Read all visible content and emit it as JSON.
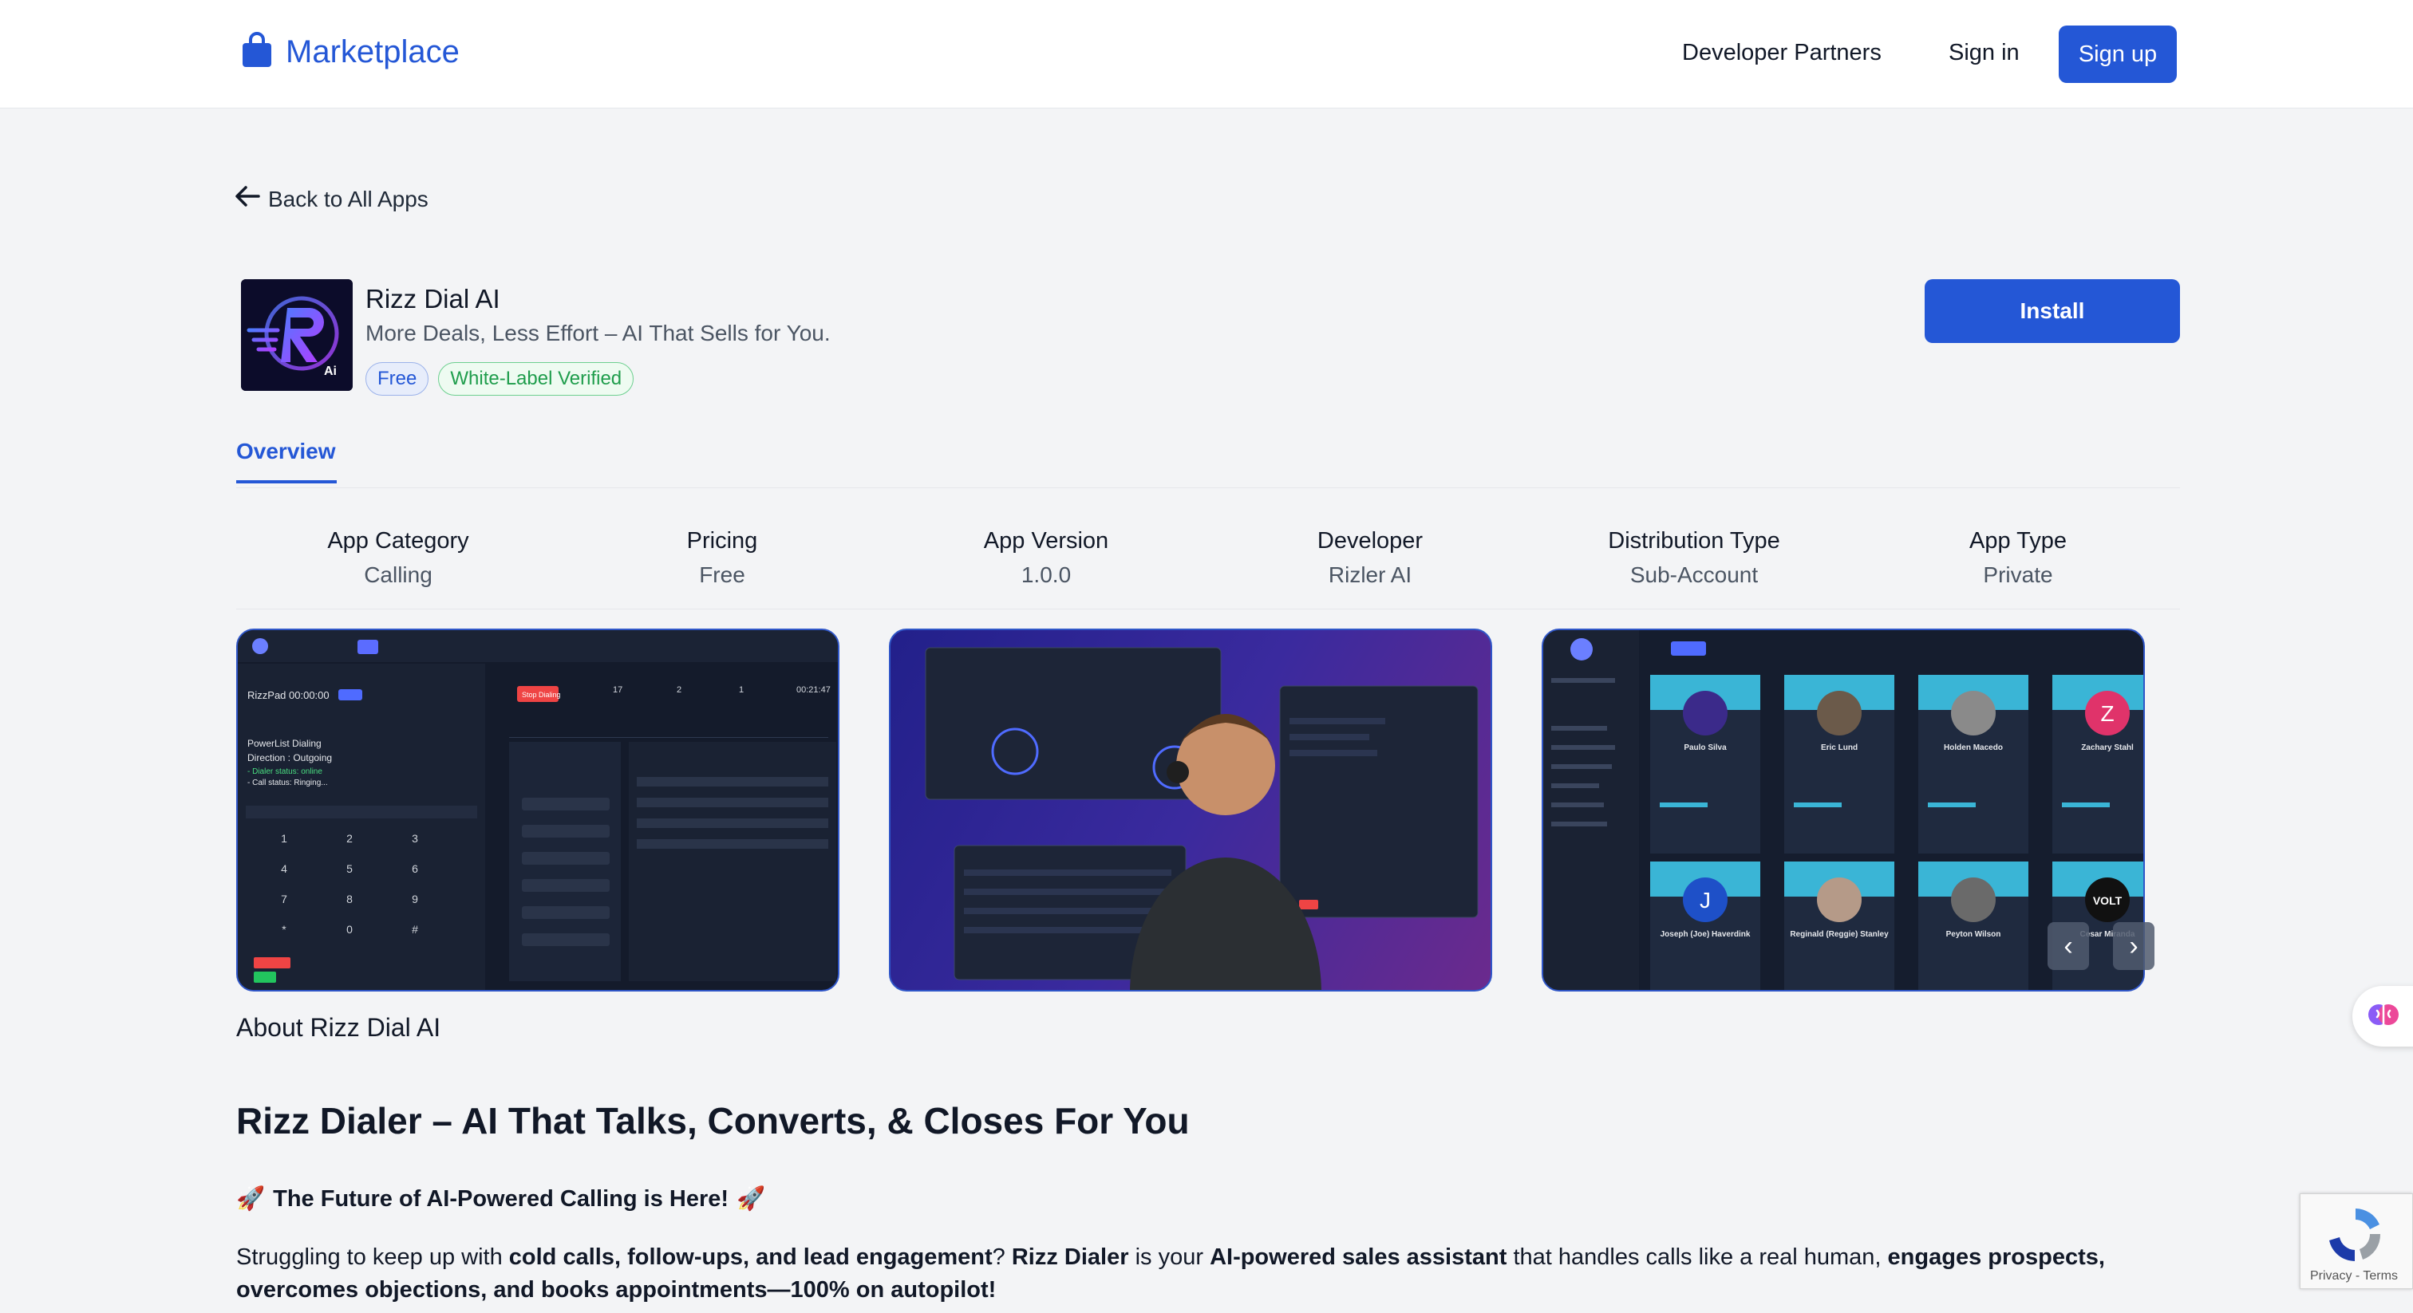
{
  "header": {
    "brand": "Marketplace",
    "nav": {
      "developer_partners": "Developer Partners",
      "sign_in": "Sign in",
      "sign_up": "Sign up"
    },
    "brand_color": "#2457d6"
  },
  "back_link": "Back to All Apps",
  "app": {
    "name": "Rizz Dial AI",
    "tagline": "More Deals, Less Effort – AI That Sells for You.",
    "badges": {
      "free": "Free",
      "white_label": "White-Label Verified"
    },
    "install_label": "Install",
    "logo_text": "Ai"
  },
  "tabs": {
    "overview": "Overview"
  },
  "info": [
    {
      "label": "App Category",
      "value": "Calling"
    },
    {
      "label": "Pricing",
      "value": "Free"
    },
    {
      "label": "App Version",
      "value": "1.0.0"
    },
    {
      "label": "Developer",
      "value": "Rizler AI"
    },
    {
      "label": "Distribution Type",
      "value": "Sub-Account"
    },
    {
      "label": "App Type",
      "value": "Private"
    }
  ],
  "screenshots": {
    "shot1": {
      "title": "RizzPad 00:00:00",
      "lines": [
        "PowerList Dialing",
        "Direction : Outgoing",
        "- Dialer status: online",
        "- Call status: Ringing..."
      ],
      "keys": [
        "1",
        "2",
        "3",
        "4",
        "5",
        "6",
        "7",
        "8",
        "9",
        "*",
        "0",
        "#"
      ],
      "stop_label": "Stop Dialing",
      "stats": [
        "17",
        "2",
        "1",
        "00:21:47"
      ]
    },
    "shot3": {
      "cards": [
        {
          "name": "Paulo Silva",
          "initial": ""
        },
        {
          "name": "Eric Lund",
          "initial": ""
        },
        {
          "name": "Holden Macedo",
          "initial": ""
        },
        {
          "name": "Zachary Stahl",
          "initial": "Z"
        },
        {
          "name": "Joseph (Joe) Haverdink",
          "initial": "J"
        },
        {
          "name": "Reginald (Reggie) Stanley",
          "initial": ""
        },
        {
          "name": "Peyton Wilson",
          "initial": ""
        },
        {
          "name": "Cesar Miranda",
          "initial": "VOLT"
        }
      ],
      "prev_label": "‹",
      "next_label": "›"
    }
  },
  "about_title": "About Rizz Dial AI",
  "content": {
    "headline": "Rizz Dialer – AI That Talks, Converts, & Closes For You",
    "subhead": "The Future of AI-Powered Calling is Here!",
    "rocket": "🚀",
    "para": {
      "p1": "Struggling to keep up with ",
      "b1": "cold calls, follow-ups, and lead engagement",
      "p2": "? ",
      "b2": "Rizz Dialer",
      "p3": " is your ",
      "b3": "AI-powered sales assistant",
      "p4": " that handles calls like a real human, ",
      "b4": "engages prospects, overcomes objections, and books appointments—100% on autopilot!"
    }
  },
  "recaptcha": {
    "privacy": "Privacy",
    "sep": " - ",
    "terms": "Terms"
  }
}
